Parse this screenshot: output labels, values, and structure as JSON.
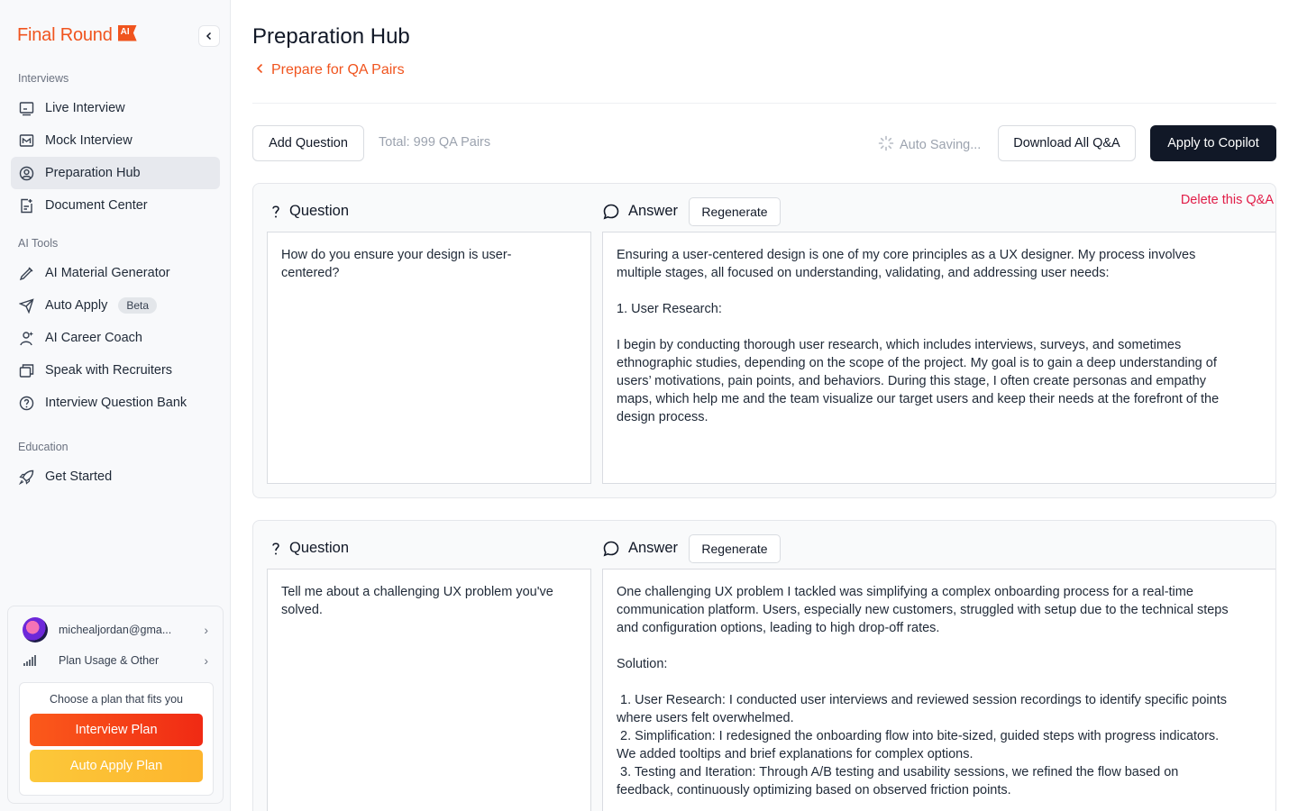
{
  "brand": {
    "name": "Final Round",
    "badge": "AI"
  },
  "sidebar": {
    "sections": [
      {
        "label": "Interviews"
      },
      {
        "label": "AI Tools"
      },
      {
        "label": "Education"
      }
    ],
    "items": [
      {
        "label": "Live Interview",
        "icon": "monitor-icon",
        "active": false
      },
      {
        "label": "Mock Interview",
        "icon": "mock-board-icon",
        "active": false
      },
      {
        "label": "Preparation Hub",
        "icon": "user-circle-icon",
        "active": true
      },
      {
        "label": "Document Center",
        "icon": "document-icon",
        "active": false
      },
      {
        "label": "AI Material Generator",
        "icon": "pen-tool-icon",
        "active": false
      },
      {
        "label": "Auto Apply",
        "icon": "send-icon",
        "active": false,
        "badge": "Beta"
      },
      {
        "label": "AI Career Coach",
        "icon": "coach-icon",
        "active": false
      },
      {
        "label": "Speak with Recruiters",
        "icon": "recruiter-icon",
        "active": false
      },
      {
        "label": "Interview Question Bank",
        "icon": "question-circle-icon",
        "active": false
      },
      {
        "label": "Get Started",
        "icon": "rocket-icon",
        "active": false
      }
    ],
    "account": {
      "email": "michealjordan@gma...",
      "plan_usage": "Plan Usage & Other",
      "plan_prompt": "Choose a plan that fits you",
      "interview_plan": "Interview Plan",
      "auto_apply_plan": "Auto Apply Plan"
    }
  },
  "header": {
    "title": "Preparation Hub",
    "back_label": "Prepare for QA Pairs"
  },
  "toolbar": {
    "add_question": "Add Question",
    "total": "Total: 999 QA Pairs",
    "saving": "Auto Saving...",
    "download": "Download All Q&A",
    "apply": "Apply to Copilot"
  },
  "qa_labels": {
    "question": "Question",
    "answer": "Answer",
    "regenerate": "Regenerate",
    "delete": "Delete this Q&A"
  },
  "qa_pairs": [
    {
      "question": "How do you ensure your design is user-\ncentered?",
      "answer": "Ensuring a user-centered design is one of my core principles as a UX designer. My process involves\nmultiple stages, all focused on understanding, validating, and addressing user needs:\n\n1. User Research:\n\nI begin by conducting thorough user research, which includes interviews, surveys, and sometimes\nethnographic studies, depending on the scope of the project. My goal is to gain a deep understanding of\nusers’ motivations, pain points, and behaviors. During this stage, I often create personas and empathy\nmaps, which help me and the team visualize our target users and keep their needs at the forefront of the\ndesign process."
    },
    {
      "question": "Tell me about a challenging UX problem you've\nsolved.",
      "answer": "One challenging UX problem I tackled was simplifying a complex onboarding process for a real-time\ncommunication platform. Users, especially new customers, struggled with setup due to the technical steps\nand configuration options, leading to high drop-off rates.\n\nSolution:\n\n 1. User Research: I conducted user interviews and reviewed session recordings to identify specific points\nwhere users felt overwhelmed.\n 2. Simplification: I redesigned the onboarding flow into bite-sized, guided steps with progress indicators.\nWe added tooltips and brief explanations for complex options.\n 3. Testing and Iteration: Through A/B testing and usability sessions, we refined the flow based on\nfeedback, continuously optimizing based on observed friction points."
    }
  ],
  "colors": {
    "brand": "#f0541e",
    "danger": "#e11d48",
    "dark": "#111827"
  }
}
